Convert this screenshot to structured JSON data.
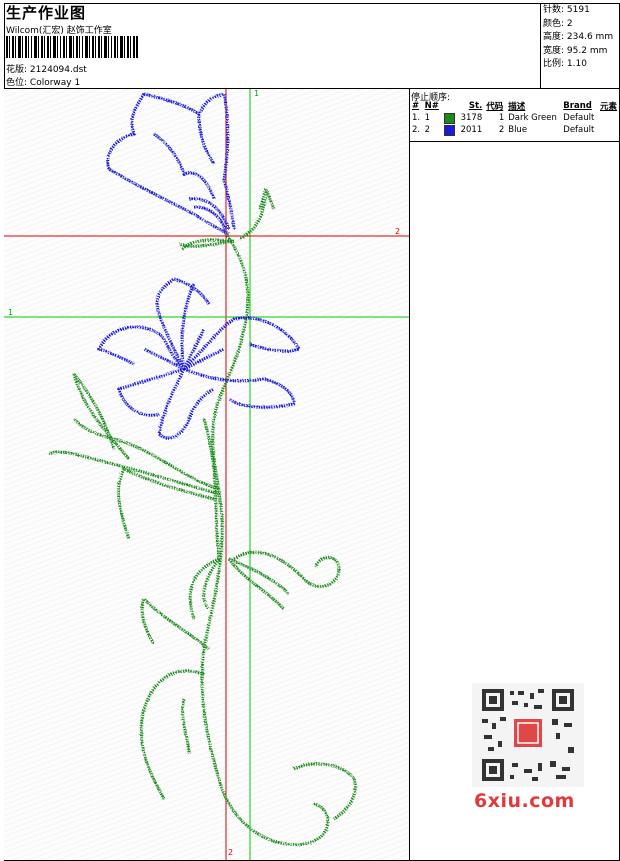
{
  "header": {
    "title": "生产作业图",
    "company": "Wilcom(汇宏) 赵饰工作室",
    "design_label": "花版:",
    "design_file": "2124094.dst",
    "colorway_label": "色位:",
    "colorway": "Colorway 1"
  },
  "stats": {
    "stitches_label": "针数:",
    "stitches": "5191",
    "colors_label": "颜色:",
    "colors": "2",
    "height_label": "高度:",
    "height": "234.6 mm",
    "width_label": "宽度:",
    "width": "95.2 mm",
    "scale_label": "比例:",
    "scale": "1.10"
  },
  "stop_sequence": {
    "label": "停止顺序:",
    "headers": [
      "#",
      "N#",
      "St.",
      "代码",
      "描述",
      "Brand",
      "元素"
    ],
    "rows": [
      {
        "num": "1.",
        "n": "1",
        "color": "#1a8a1a",
        "st": "3178",
        "code": "1",
        "desc": "Dark Green",
        "brand": "Default"
      },
      {
        "num": "2.",
        "n": "2",
        "color": "#1a1ad8",
        "st": "2011",
        "code": "2",
        "desc": "Blue",
        "brand": "Default"
      }
    ]
  },
  "crosshairs": {
    "green_top": "1",
    "green_left": "1",
    "red_right": "2",
    "red_bottom": "2"
  },
  "watermark": "6xiu.com",
  "colors": {
    "thread_green": "#1a8a1a",
    "thread_blue": "#1a1ad8",
    "axis_red": "#e00000",
    "axis_green": "#00cc00"
  }
}
